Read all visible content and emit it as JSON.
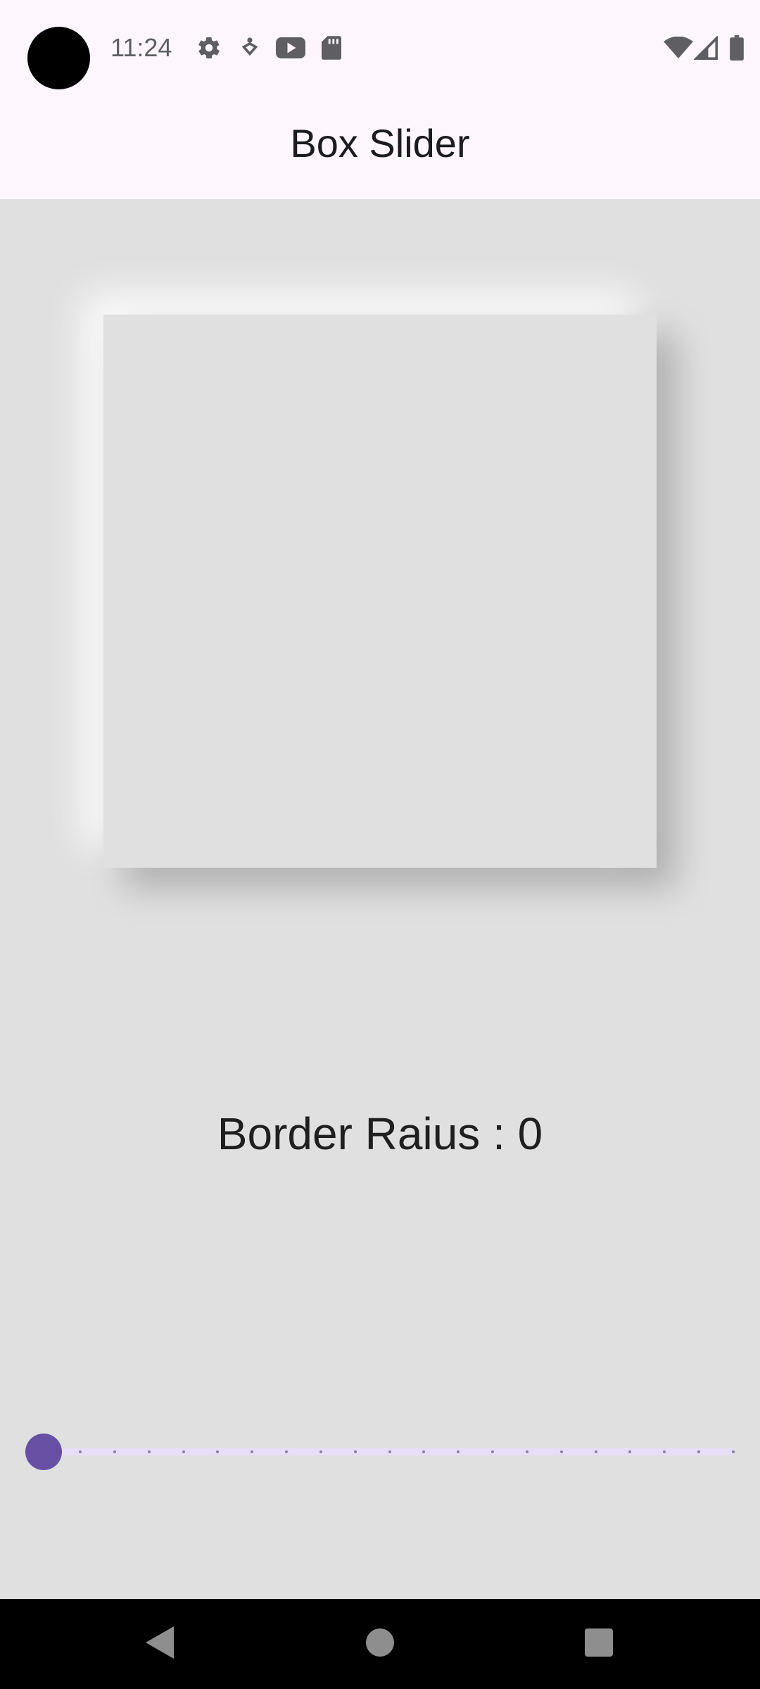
{
  "status_bar": {
    "time": "11:24",
    "notification_icons": [
      "settings-icon",
      "location-accessibility-icon",
      "youtube-icon",
      "sd-card-icon"
    ],
    "system_icons": [
      "wifi-icon",
      "cellular-signal-icon",
      "battery-icon"
    ]
  },
  "app_bar": {
    "title": "Box Slider"
  },
  "main": {
    "radius_label": "Border Raius : 0",
    "slider": {
      "value": 0,
      "min": 0,
      "max": 20,
      "divisions": 20
    }
  },
  "navigation_bar": {
    "buttons": [
      "back-icon",
      "home-icon",
      "recents-icon"
    ]
  },
  "colors": {
    "accent": "#6750a4",
    "track": "#e8def8",
    "surface": "#fdf7fd",
    "background": "#e0e0e0"
  }
}
